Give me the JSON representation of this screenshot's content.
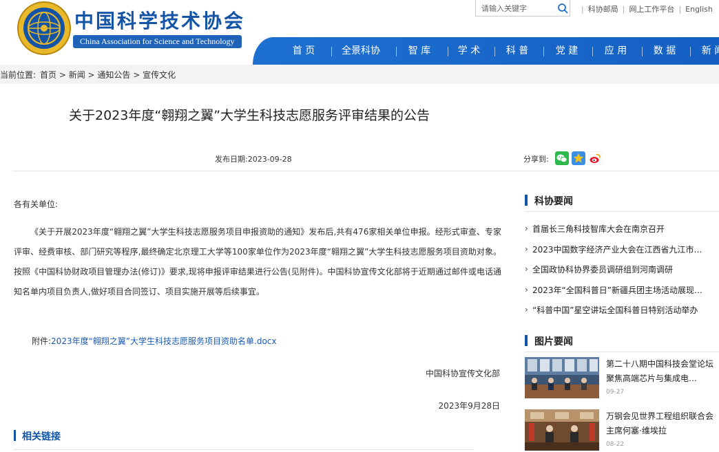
{
  "header": {
    "brand_cn": "中国科学技术协会",
    "brand_en": "China Association for Science and Technology",
    "search_placeholder": "请输入关键字",
    "top_links": [
      "科协邮局",
      "网上工作平台",
      "English"
    ]
  },
  "nav": {
    "items": [
      "首 页",
      "全景科协",
      "智 库",
      "学 术",
      "科 普",
      "党 建",
      "应 用",
      "数 据",
      "新 闻"
    ]
  },
  "breadcrumb": {
    "label": "当前位置:",
    "path": "首页 > 新闻 > 通知公告 > 宣传文化"
  },
  "article": {
    "title": "关于2023年度“翱翔之翼”大学生科技志愿服务评审结果的公告",
    "pubdate": "发布日期:2023-09-28",
    "share_label": "分享到:",
    "salutation": "各有关单位:",
    "body": "《关于开展2023年度“翱翔之翼”大学生科技志愿服务项目申报资助的通知》发布后,共有476家相关单位申报。经形式审查、专家评审、经费审核、部门研究等程序,最终确定北京理工大学等100家单位作为2023年度“翱翔之翼”大学生科技志愿服务项目资助对象。按照《中国科协财政项目管理办法(修订)》要求,现将申报评审结果进行公告(见附件)。中国科协宣传文化部将于近期通过邮件或电话通知名单内项目负责人,做好项目合同签订、项目实施开展等后续事宜。",
    "attachment_label": "附件:",
    "attachment_link": "2023年度“翱翔之翼”大学生科技志愿服务项目资助名单.docx",
    "signature": "中国科协宣传文化部",
    "sign_date": "2023年9月28日",
    "related_heading": "相关链接"
  },
  "sidebar": {
    "news_heading": "科协要闻",
    "news": [
      "首届长三角科技智库大会在南京召开",
      "2023中国数字经济产业大会在江西省九江市…",
      "全国政协科协界委员调研组到河南调研",
      "2023年“全国科普日”新疆兵团主场活动展现…",
      "“科普中国”星空讲坛全国科普日特别活动举办"
    ],
    "pics_heading": "图片要闻",
    "pics": [
      {
        "title": "第二十八期中国科技会堂论坛聚焦高端芯片与集成电…",
        "date": "09-27"
      },
      {
        "title": "万钢会见世界工程组织联合会主席何塞·维埃拉",
        "date": "08-22"
      }
    ]
  },
  "colors": {
    "brand_blue": "#1454a6",
    "nav_blue": "#1d6fd0",
    "link_blue": "#1a5bb3"
  },
  "icons": {
    "share": [
      "wechat-icon",
      "qzone-icon",
      "weibo-icon"
    ]
  }
}
